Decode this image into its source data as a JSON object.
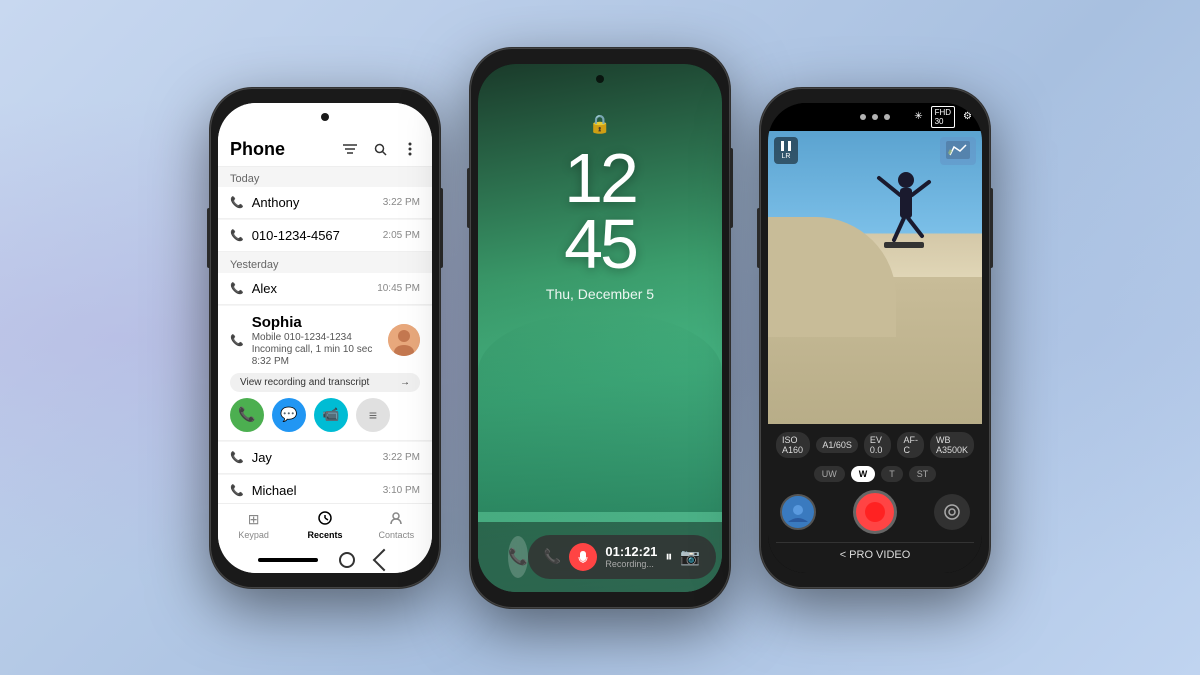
{
  "background": {
    "gradient": "linear-gradient(135deg, #c8d8f0, #a8c0e0)"
  },
  "phone1": {
    "title": "Phone",
    "section_today": "Today",
    "section_yesterday": "Yesterday",
    "contacts": [
      {
        "name": "Anthony",
        "time": "3:22 PM",
        "type": "call"
      },
      {
        "name": "010-1234-4567",
        "time": "2:05 PM",
        "type": "call"
      },
      {
        "name": "Alex",
        "time": "10:45 PM",
        "type": "call"
      },
      {
        "name": "Sophia",
        "time": "",
        "type": "expanded"
      },
      {
        "name": "Jay",
        "time": "3:22 PM",
        "type": "call"
      },
      {
        "name": "Michael",
        "time": "3:10 PM",
        "type": "call"
      }
    ],
    "sophia": {
      "name": "Sophia",
      "number": "Mobile 010-1234-1234",
      "call_detail": "Incoming call, 1 min 10 sec",
      "time": "8:32 PM",
      "recording_btn": "View recording and transcript"
    },
    "nav_tabs": [
      {
        "label": "Keypad",
        "icon": "⊞",
        "active": false
      },
      {
        "label": "Recents",
        "icon": "📞",
        "active": true
      },
      {
        "label": "Contacts",
        "icon": "👤",
        "active": false
      }
    ]
  },
  "phone2": {
    "time": "12",
    "time2": "45",
    "date": "Thu, December 5",
    "lock_icon": "🔒",
    "recording_time": "01:12:21",
    "recording_label": "Recording..."
  },
  "phone3": {
    "iso": "ISO A160",
    "shutter": "A1/60S",
    "ev": "EV 0.0",
    "af": "AF-C",
    "wb": "WB A3500K",
    "lenses": [
      "UW",
      "W",
      "T",
      "ST"
    ],
    "active_lens": "W",
    "label": "< PRO VIDEO",
    "fhd": "FHD\n30"
  }
}
